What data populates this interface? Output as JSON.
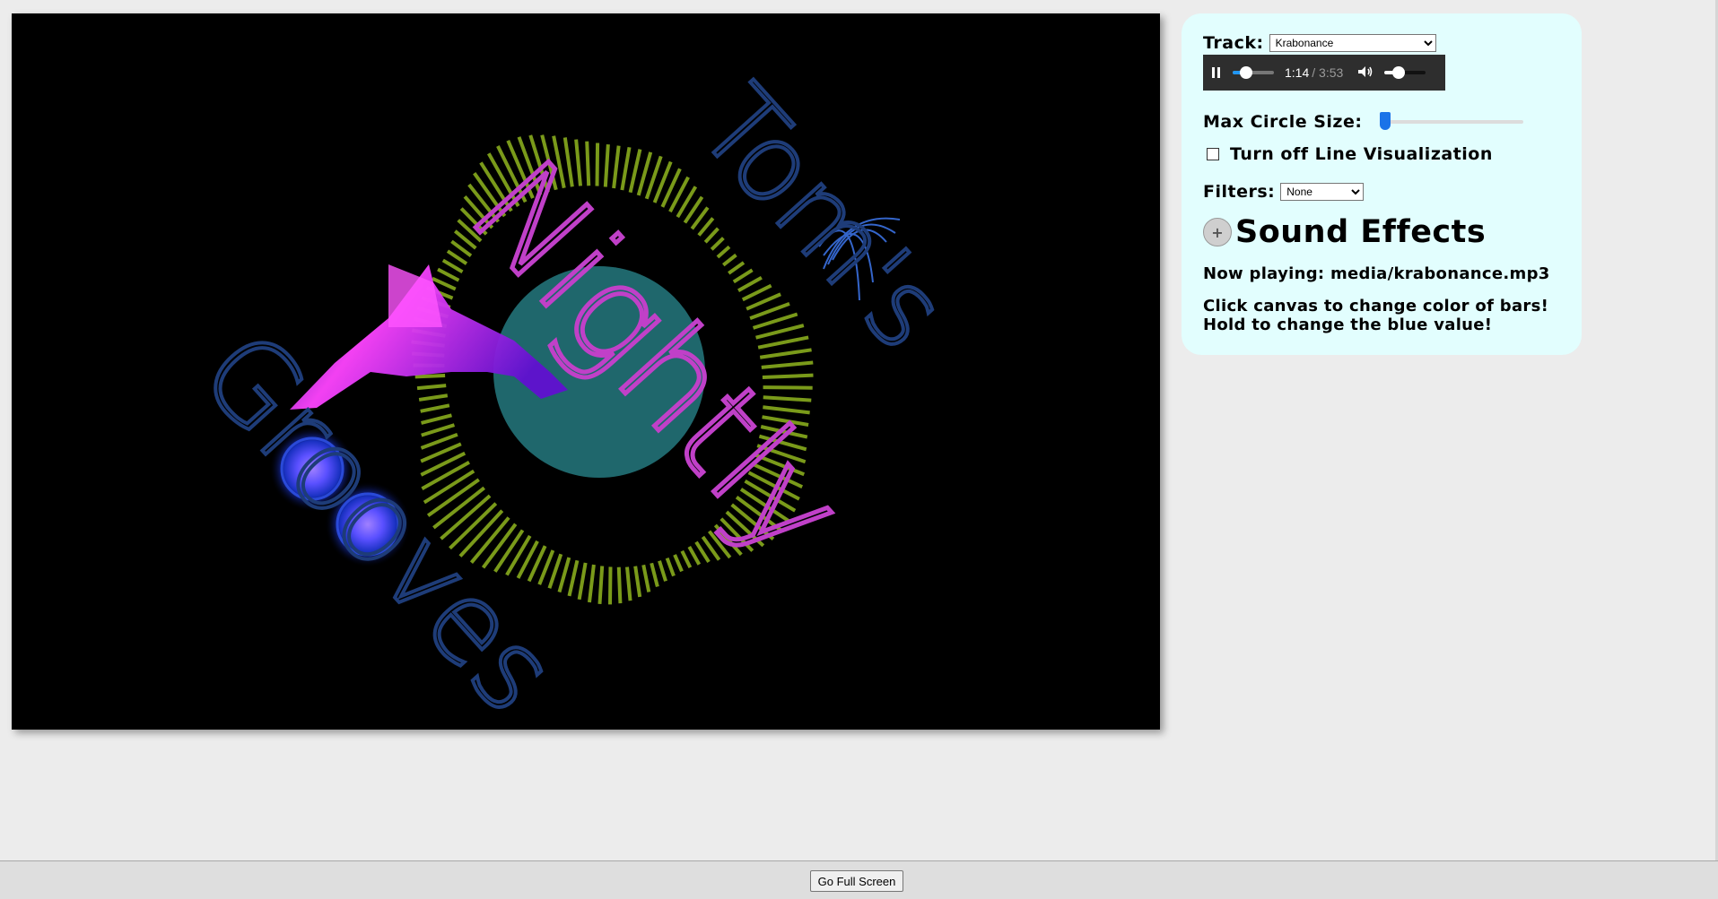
{
  "canvas": {
    "logo_word_1": "Tom's",
    "logo_word_2": "Nightly",
    "logo_word_3": "Grooves"
  },
  "controls": {
    "track_label": "Track:",
    "track_selected": "Krabonance",
    "player": {
      "current_time": "1:14",
      "duration": "/ 3:53",
      "progress_fraction": 0.32,
      "volume_fraction": 0.35,
      "play_state_icon": "pause-icon",
      "volume_icon": "speaker-icon"
    },
    "max_circle_label": "Max Circle Size:",
    "max_circle_value": 0,
    "line_viz_label": "Turn off Line Visualization",
    "line_viz_checked": false,
    "filters_label": "Filters:",
    "filters_selected": "None",
    "sound_effects_title": "Sound Effects",
    "sound_effects_icon": "plus-icon",
    "now_playing": "Now playing: media/krabonance.mp3",
    "hint_line_1": "Click canvas to change color of bars!",
    "hint_line_2": "Hold to change the blue value!"
  },
  "footer": {
    "fullscreen_label": "Go Full Screen"
  },
  "colors": {
    "canvas_bg": "#000000",
    "panel_bg": "#e2fefe",
    "bars": "#7a9a1a",
    "center_circle": "#2a8a90",
    "logo_tom_grooves": "#1e3c78",
    "logo_nightly": "#c040c8",
    "wave_pink": "#ff44ff",
    "orbs": "#3050ff"
  }
}
